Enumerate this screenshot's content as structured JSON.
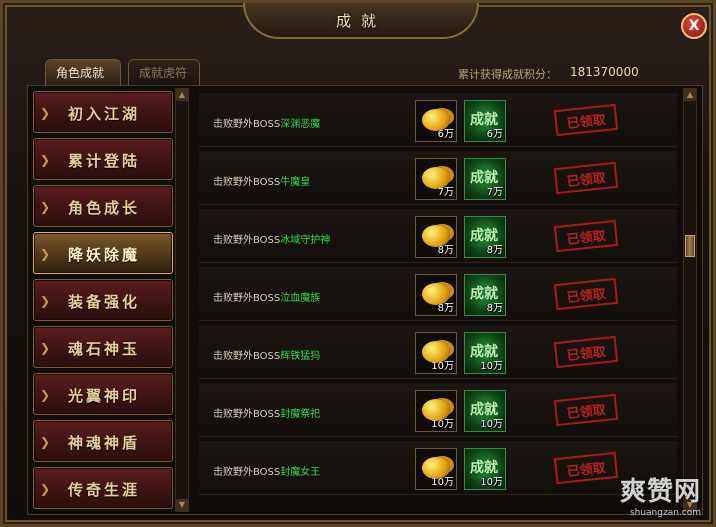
{
  "window": {
    "title": "成就",
    "close_label": "X"
  },
  "tabs": [
    {
      "label": "角色成就",
      "active": true
    },
    {
      "label": "成就虎符",
      "active": false
    }
  ],
  "summary": {
    "total_label": "累计获得成就积分：",
    "total_value": "181370000"
  },
  "sidebar": {
    "items": [
      {
        "label": "初入江湖",
        "active": false
      },
      {
        "label": "累计登陆",
        "active": false
      },
      {
        "label": "角色成长",
        "active": false
      },
      {
        "label": "降妖除魔",
        "active": true
      },
      {
        "label": "装备强化",
        "active": false
      },
      {
        "label": "魂石神玉",
        "active": false
      },
      {
        "label": "光翼神印",
        "active": false
      },
      {
        "label": "神魂神盾",
        "active": false
      },
      {
        "label": "传奇生涯",
        "active": false
      }
    ]
  },
  "achievements": [
    {
      "prefix": "击败野外BOSS",
      "boss": "深渊恶魔",
      "gold": "6万",
      "points": "6万",
      "points_label": "成就",
      "status": "已领取"
    },
    {
      "prefix": "击败野外BOSS",
      "boss": "牛魔皇",
      "gold": "7万",
      "points": "7万",
      "points_label": "成就",
      "status": "已领取"
    },
    {
      "prefix": "击败野外BOSS",
      "boss": "冰域守护神",
      "gold": "8万",
      "points": "8万",
      "points_label": "成就",
      "status": "已领取"
    },
    {
      "prefix": "击败野外BOSS",
      "boss": "泣血魔族",
      "gold": "8万",
      "points": "8万",
      "points_label": "成就",
      "status": "已领取"
    },
    {
      "prefix": "击败野外BOSS",
      "boss": "辉铁猛犸",
      "gold": "10万",
      "points": "10万",
      "points_label": "成就",
      "status": "已领取"
    },
    {
      "prefix": "击败野外BOSS",
      "boss": "封魔祭祀",
      "gold": "10万",
      "points": "10万",
      "points_label": "成就",
      "status": "已领取"
    },
    {
      "prefix": "击败野外BOSS",
      "boss": "封魔女王",
      "gold": "10万",
      "points": "10万",
      "points_label": "成就",
      "status": "已领取"
    }
  ],
  "scrollbars": {
    "up_glyph": "▲",
    "down_glyph": "▼"
  },
  "watermark": {
    "main": "爽赞网",
    "sub": "shuangzan.com"
  },
  "colors": {
    "boss_name": "#36d94a",
    "stamp": "#c92424",
    "accent_gold": "#d9b56a"
  }
}
